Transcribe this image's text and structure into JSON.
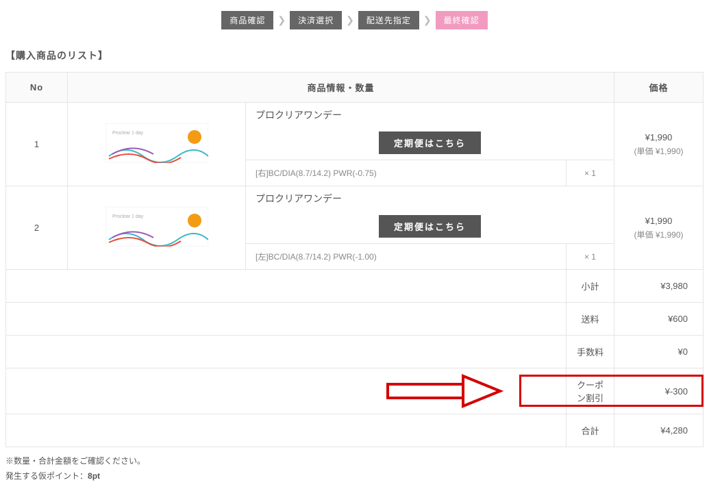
{
  "stepper": {
    "steps": [
      {
        "label": "商品確認",
        "active": false
      },
      {
        "label": "決済選択",
        "active": false
      },
      {
        "label": "配送先指定",
        "active": false
      },
      {
        "label": "最終確認",
        "active": true
      }
    ]
  },
  "section_title": "【購入商品のリスト】",
  "table": {
    "headers": {
      "no": "No",
      "info": "商品情報・数量",
      "price": "価格"
    },
    "rows": [
      {
        "no": "1",
        "name": "プロクリアワンデー",
        "sub_button": "定期便はこちら",
        "spec": "[右]BC/DIA(8.7/14.2) PWR(-0.75)",
        "qty": "× 1",
        "price": "¥1,990",
        "unit_price": "(単価 ¥1,990)"
      },
      {
        "no": "2",
        "name": "プロクリアワンデー",
        "sub_button": "定期便はこちら",
        "spec": "[左]BC/DIA(8.7/14.2) PWR(-1.00)",
        "qty": "× 1",
        "price": "¥1,990",
        "unit_price": "(単価 ¥1,990)"
      }
    ],
    "summary": [
      {
        "label": "小計",
        "value": "¥3,980",
        "highlight": false
      },
      {
        "label": "送料",
        "value": "¥600",
        "highlight": false
      },
      {
        "label": "手数料",
        "value": "¥0",
        "highlight": false
      },
      {
        "label": "クーポン割引",
        "value": "¥-300",
        "highlight": true
      },
      {
        "label": "合計",
        "value": "¥4,280",
        "highlight": false
      }
    ]
  },
  "notes": {
    "line1": "※数量・合計金額をご確認ください。",
    "line2_prefix": "発生する仮ポイント：",
    "line2_value": "8pt"
  }
}
